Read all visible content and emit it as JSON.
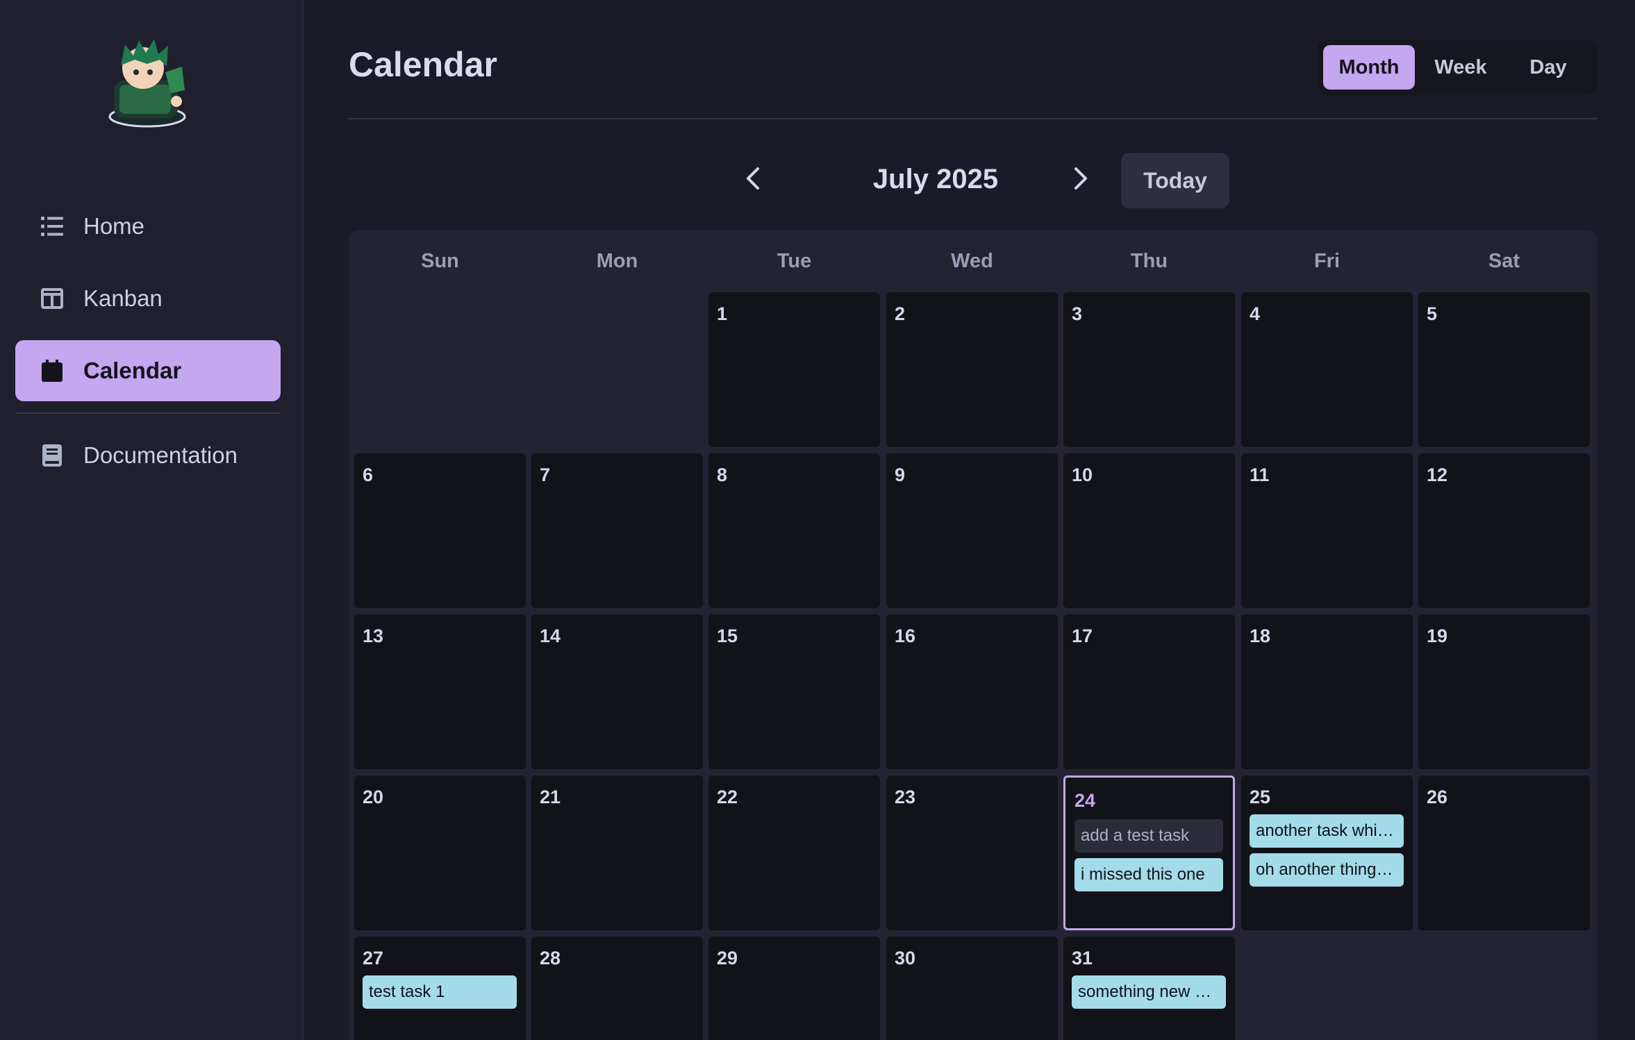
{
  "sidebar": {
    "items": [
      {
        "label": "Home",
        "icon": "list-icon",
        "active": false
      },
      {
        "label": "Kanban",
        "icon": "columns-icon",
        "active": false
      },
      {
        "label": "Calendar",
        "icon": "calendar-icon",
        "active": true
      },
      {
        "label": "Documentation",
        "icon": "book-icon",
        "active": false
      }
    ]
  },
  "header": {
    "title": "Calendar",
    "views": [
      "Month",
      "Week",
      "Day"
    ],
    "active_view": "Month"
  },
  "month_nav": {
    "label": "July 2025",
    "today": "Today"
  },
  "weekdays": [
    "Sun",
    "Mon",
    "Tue",
    "Wed",
    "Thu",
    "Fri",
    "Sat"
  ],
  "days": [
    {
      "n": "1",
      "col": 2,
      "row": 0,
      "tasks": []
    },
    {
      "n": "2",
      "col": 3,
      "row": 0,
      "tasks": []
    },
    {
      "n": "3",
      "col": 4,
      "row": 0,
      "tasks": []
    },
    {
      "n": "4",
      "col": 5,
      "row": 0,
      "tasks": []
    },
    {
      "n": "5",
      "col": 6,
      "row": 0,
      "tasks": []
    },
    {
      "n": "6",
      "col": 0,
      "row": 1,
      "tasks": []
    },
    {
      "n": "7",
      "col": 1,
      "row": 1,
      "tasks": []
    },
    {
      "n": "8",
      "col": 2,
      "row": 1,
      "tasks": []
    },
    {
      "n": "9",
      "col": 3,
      "row": 1,
      "tasks": []
    },
    {
      "n": "10",
      "col": 4,
      "row": 1,
      "tasks": []
    },
    {
      "n": "11",
      "col": 5,
      "row": 1,
      "tasks": []
    },
    {
      "n": "12",
      "col": 6,
      "row": 1,
      "tasks": []
    },
    {
      "n": "13",
      "col": 0,
      "row": 2,
      "tasks": []
    },
    {
      "n": "14",
      "col": 1,
      "row": 2,
      "tasks": []
    },
    {
      "n": "15",
      "col": 2,
      "row": 2,
      "tasks": []
    },
    {
      "n": "16",
      "col": 3,
      "row": 2,
      "tasks": []
    },
    {
      "n": "17",
      "col": 4,
      "row": 2,
      "tasks": []
    },
    {
      "n": "18",
      "col": 5,
      "row": 2,
      "tasks": []
    },
    {
      "n": "19",
      "col": 6,
      "row": 2,
      "tasks": []
    },
    {
      "n": "20",
      "col": 0,
      "row": 3,
      "tasks": []
    },
    {
      "n": "21",
      "col": 1,
      "row": 3,
      "tasks": []
    },
    {
      "n": "22",
      "col": 2,
      "row": 3,
      "tasks": []
    },
    {
      "n": "23",
      "col": 3,
      "row": 3,
      "tasks": []
    },
    {
      "n": "24",
      "col": 4,
      "row": 3,
      "today": true,
      "tasks": [
        {
          "text": "add a test task",
          "muted": true
        },
        {
          "text": "i missed this one",
          "muted": false
        }
      ]
    },
    {
      "n": "25",
      "col": 5,
      "row": 3,
      "tasks": [
        {
          "text": "another task whi…",
          "muted": false
        },
        {
          "text": "oh another thing,…",
          "muted": false
        }
      ]
    },
    {
      "n": "26",
      "col": 6,
      "row": 3,
      "tasks": []
    },
    {
      "n": "27",
      "col": 0,
      "row": 4,
      "tasks": [
        {
          "text": "test task 1",
          "muted": false
        }
      ]
    },
    {
      "n": "28",
      "col": 1,
      "row": 4,
      "tasks": []
    },
    {
      "n": "29",
      "col": 2,
      "row": 4,
      "tasks": []
    },
    {
      "n": "30",
      "col": 3,
      "row": 4,
      "tasks": []
    },
    {
      "n": "31",
      "col": 4,
      "row": 4,
      "tasks": [
        {
          "text": "something new n…",
          "muted": false
        }
      ]
    }
  ],
  "colors": {
    "accent": "#c5a6f1",
    "task": "#a3dbe9",
    "background": "#1b1b27"
  }
}
